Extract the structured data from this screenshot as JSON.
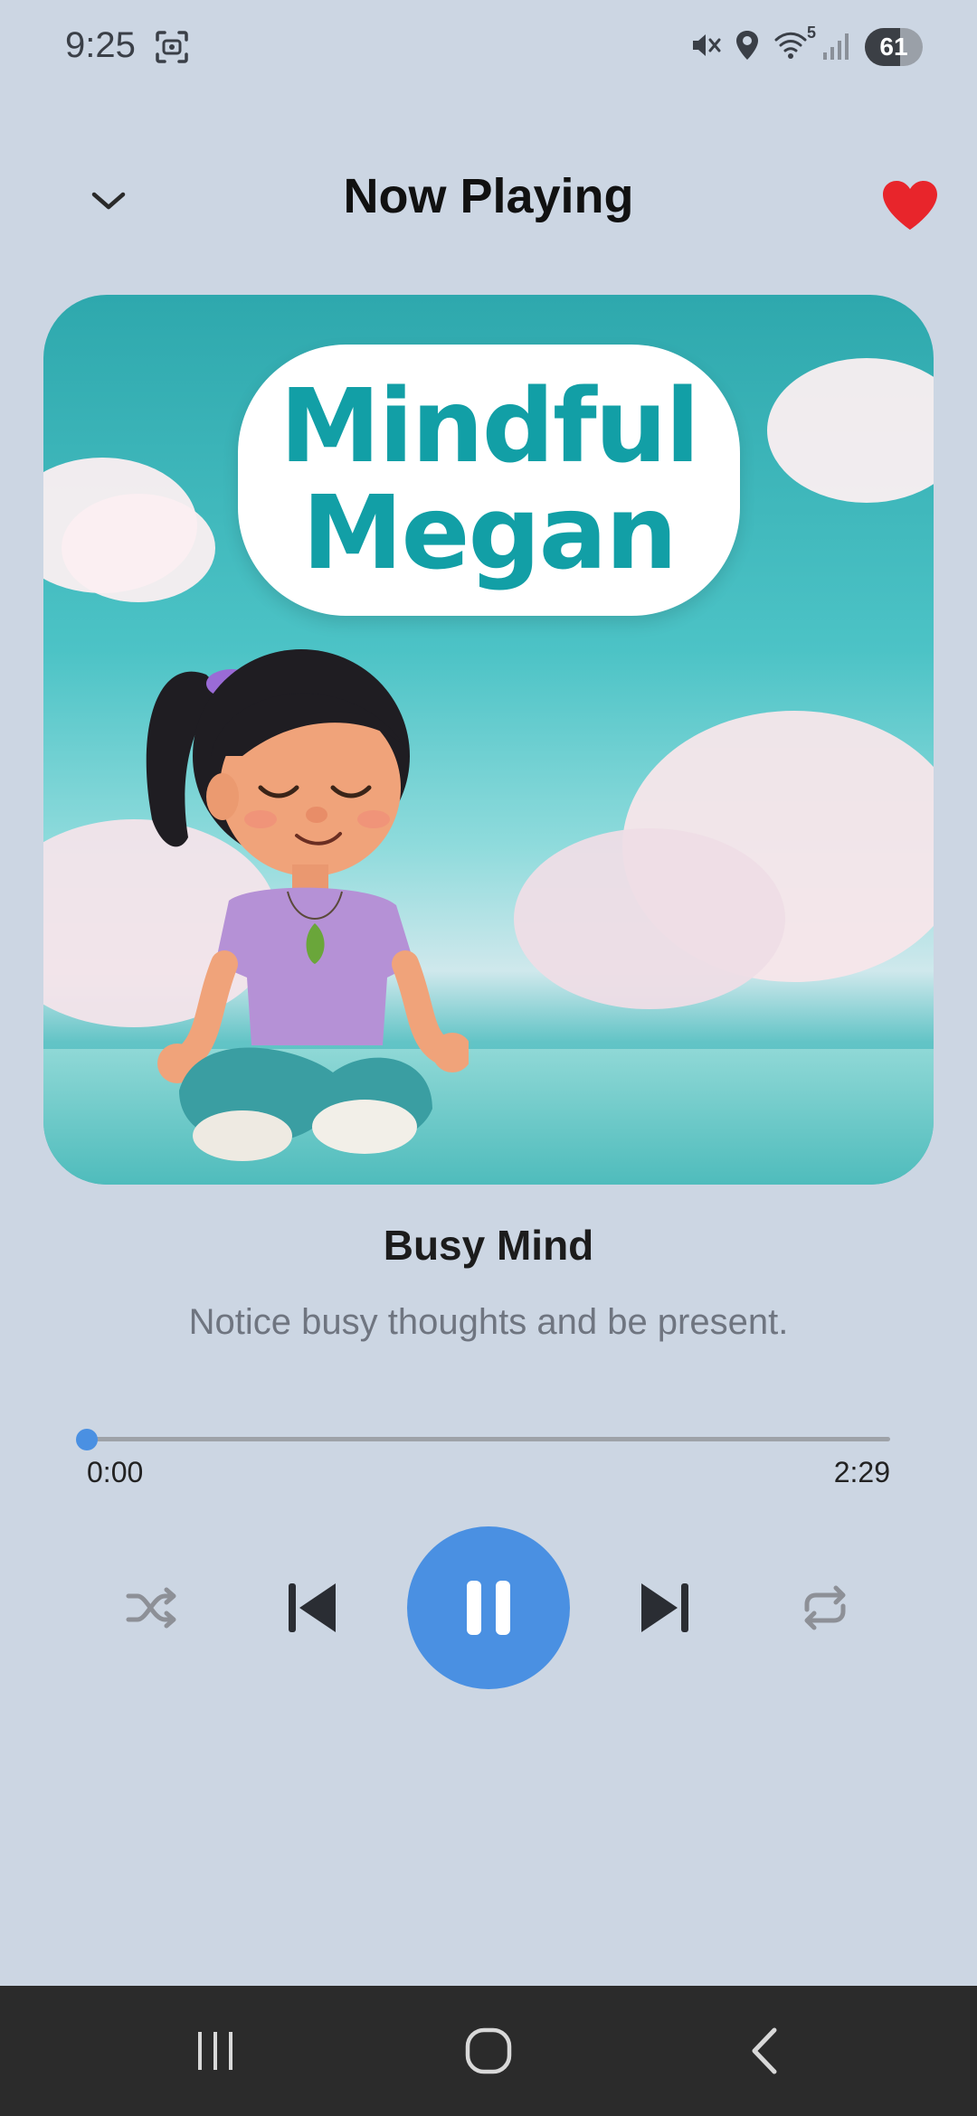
{
  "status_bar": {
    "time": "9:25",
    "battery_level": "61",
    "battery_fraction": 0.61,
    "network_badge": "5",
    "icons": [
      "screenshot-icon",
      "mute-icon",
      "location-icon",
      "wifi-icon",
      "signal-icon",
      "battery-icon"
    ]
  },
  "header": {
    "title": "Now Playing",
    "collapse_icon": "chevron-down-icon",
    "favorite_icon": "heart-icon",
    "favorited": true
  },
  "artwork": {
    "logo_line1": "Mindful",
    "logo_line2": "Megan"
  },
  "track": {
    "title": "Busy Mind",
    "description": "Notice busy thoughts and be present."
  },
  "playback": {
    "current_time": "0:00",
    "total_time": "2:29",
    "progress_fraction": 0.0,
    "state": "playing",
    "controls": [
      "shuffle-icon",
      "skip-previous-icon",
      "pause-icon",
      "skip-next-icon",
      "repeat-icon"
    ]
  },
  "navigation_bar": {
    "buttons": [
      "recents-icon",
      "home-icon",
      "back-icon"
    ]
  },
  "colors": {
    "background": "#ccd6e3",
    "accent": "#4a90e2",
    "heart": "#e8252b",
    "nav_bar": "#2b2b2b",
    "logo_text": "#129fa6"
  }
}
